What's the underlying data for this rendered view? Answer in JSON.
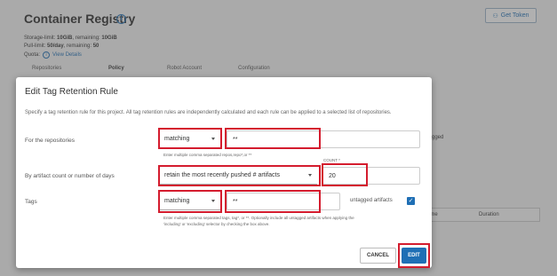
{
  "background": {
    "title": "Container Registry",
    "get_token_label": "Get Token",
    "storage_prefix": "Storage-limit: ",
    "storage_limit": "10GiB",
    "storage_mid": ", remaining: ",
    "storage_remaining": "10GiB",
    "pull_prefix": "Pull-limit: ",
    "pull_limit": "50/day",
    "pull_mid": ", remaining: ",
    "pull_remaining": "50",
    "quota_label": "Quota:",
    "view_details": "View Details",
    "tabs": [
      "Repositories",
      "Policy",
      "Robot Account",
      "Configuration"
    ],
    "right_text": "gged",
    "table_headers": [
      "ime",
      "Duration"
    ]
  },
  "modal": {
    "title": "Edit Tag Retention Rule",
    "description": "Specify a tag retention rule for this project. All tag retention rules are independently calculated and each rule can be applied to a selected list of repositories.",
    "repositories": {
      "label": "For the repositories",
      "selector": "matching",
      "value": "**",
      "hint": "Enter multiple comma separated repos,repo*,or **"
    },
    "artifact_count": {
      "label": "By artifact count or number of days",
      "selector": "retain the most recently pushed # artifacts",
      "count_label": "COUNT *",
      "count_value": "20"
    },
    "tags": {
      "label": "Tags",
      "selector": "matching",
      "value": "**",
      "hint_line1": "Enter multiple comma separated tags, tag*, or **. Optionally include all untagged artifacts when applying the",
      "hint_line2": "'including' or 'excluding' selector by checking the box above.",
      "untagged_label": "untagged artifacts",
      "untagged_checked": true
    },
    "cancel_label": "CANCEL",
    "edit_label": "EDIT"
  },
  "colors": {
    "accent": "#1f6fb5",
    "highlight": "#d41c2e"
  }
}
